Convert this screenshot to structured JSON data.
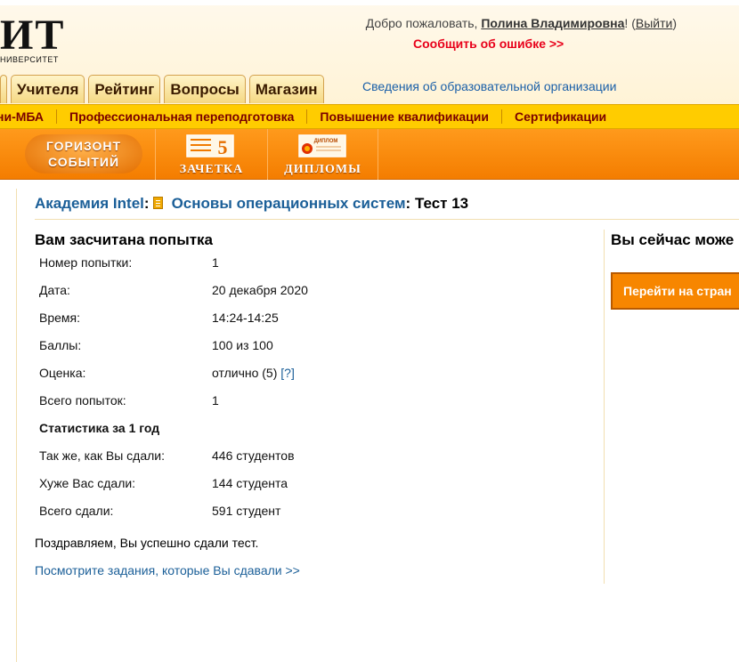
{
  "header": {
    "logo_main": "ИТ",
    "logo_sub": "НИВЕРСИТЕТ",
    "welcome_prefix": "Добро пожаловать, ",
    "user_name": "Полина Владимировна",
    "welcome_mid": "! (",
    "logout": "Выйти",
    "welcome_suffix": ")",
    "report_error": "Сообщить об ошибке >>"
  },
  "tabs": [
    "Учителя",
    "Рейтинг",
    "Вопросы",
    "Магазин"
  ],
  "org_link": "Сведения об образовательной организации",
  "yellow_nav": [
    "ни-МБА",
    "Профессиональная переподготовка",
    "Повышение квалификации",
    "Сертификации"
  ],
  "orange_bar": {
    "horizon_line1": "ГОРИЗОНТ",
    "horizon_line2": "СОБЫТИЙ",
    "zachetka": "ЗАЧЕТКА",
    "zachetka_number": "5",
    "diplomy": "ДИПЛОМЫ",
    "diploma_word": "ДИПЛОМ"
  },
  "breadcrumb": {
    "academy": "Академия Intel",
    "sep1": ":",
    "course": "Основы операционных систем",
    "sep2": ":",
    "test": "Тест 13"
  },
  "result": {
    "title": "Вам засчитана попытка",
    "rows": [
      {
        "key": "Номер попытки:",
        "value": "1"
      },
      {
        "key": "Дата:",
        "value": "20 декабря 2020"
      },
      {
        "key": "Время:",
        "value": "14:24-14:25"
      },
      {
        "key": "Баллы:",
        "value": "100 из 100"
      },
      {
        "key": "Оценка:",
        "value": "отлично (5)",
        "help": "[?]"
      },
      {
        "key": "Всего попыток:",
        "value": "1"
      }
    ],
    "stats_title": "Статистика за 1 год",
    "stats": [
      {
        "key": "Так же, как Вы сдали:",
        "value": "446 студентов"
      },
      {
        "key": "Хуже Вас сдали:",
        "value": "144 студента"
      },
      {
        "key": "Всего сдали:",
        "value": "591 студент"
      }
    ],
    "congrats": "Поздравляем, Вы успешно сдали тест.",
    "view_tasks": "Посмотрите задания, которые Вы сдавали >>"
  },
  "sidebar": {
    "title": "Вы сейчас може",
    "button": "Перейти на стран"
  },
  "colors": {
    "link": "#1b5f98",
    "nav_yellow": "#ffcc00",
    "orange": "#f78600",
    "error_red": "#e8001a"
  }
}
